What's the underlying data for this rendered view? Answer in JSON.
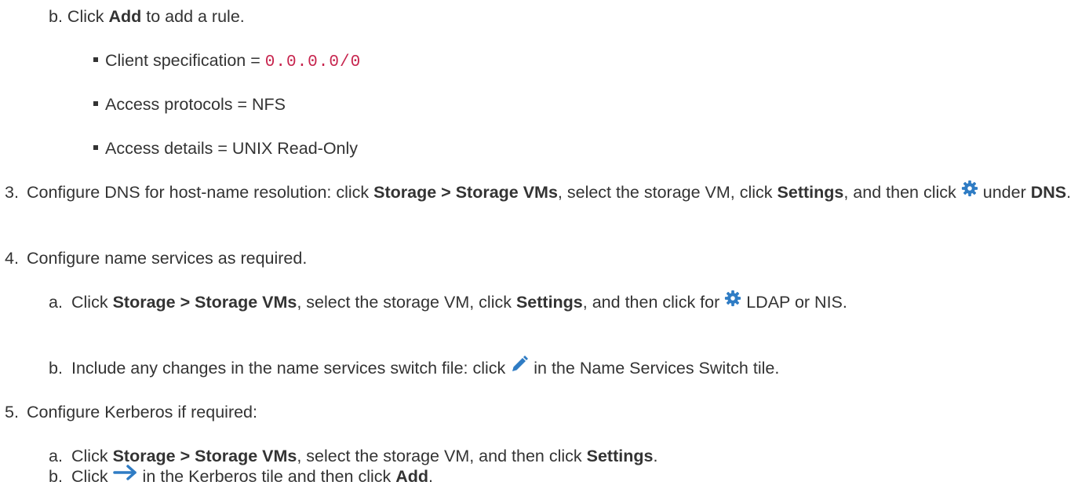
{
  "doc": {
    "step_b_add": {
      "marker": "b.",
      "pre": "Click ",
      "bold": "Add",
      "post": " to add a rule."
    },
    "bullets": [
      {
        "pre": "Client specification = ",
        "code": "0.0.0.0/0"
      },
      {
        "text": "Access protocols = NFS"
      },
      {
        "text": "Access details = UNIX Read-Only"
      }
    ],
    "step3": {
      "marker": "3.",
      "t1": "Configure DNS for host-name resolution: click ",
      "b1": "Storage > Storage VMs",
      "t2": ", select the storage VM, click ",
      "b2": "Settings",
      "t3": ", and then click ",
      "t4": " under ",
      "b3": "DNS",
      "t5": "."
    },
    "step4": {
      "marker": "4.",
      "text": "Configure name services as required.",
      "a": {
        "marker": "a.",
        "t1": "Click ",
        "b1": "Storage > Storage VMs",
        "t2": ", select the storage VM, click ",
        "b2": "Settings",
        "t3": ", and then click for ",
        "t4": " LDAP or NIS."
      },
      "b": {
        "marker": "b.",
        "t1": "Include any changes in the name services switch file: click ",
        "t2": " in the Name Services Switch tile."
      }
    },
    "step5": {
      "marker": "5.",
      "text": "Configure Kerberos if required:",
      "a": {
        "marker": "a.",
        "t1": "Click ",
        "b1": "Storage > Storage VMs",
        "t2": ", select the storage VM, and then click ",
        "b2": "Settings",
        "t3": "."
      },
      "b": {
        "marker": "b.",
        "t1": "Click ",
        "t2": " in the Kerberos tile and then click ",
        "b1": "Add",
        "t3": "."
      }
    },
    "icons": {
      "gear": "gear-icon",
      "pencil": "pencil-icon",
      "arrow": "arrow-right-icon",
      "accent": "#2f7cc4"
    }
  }
}
